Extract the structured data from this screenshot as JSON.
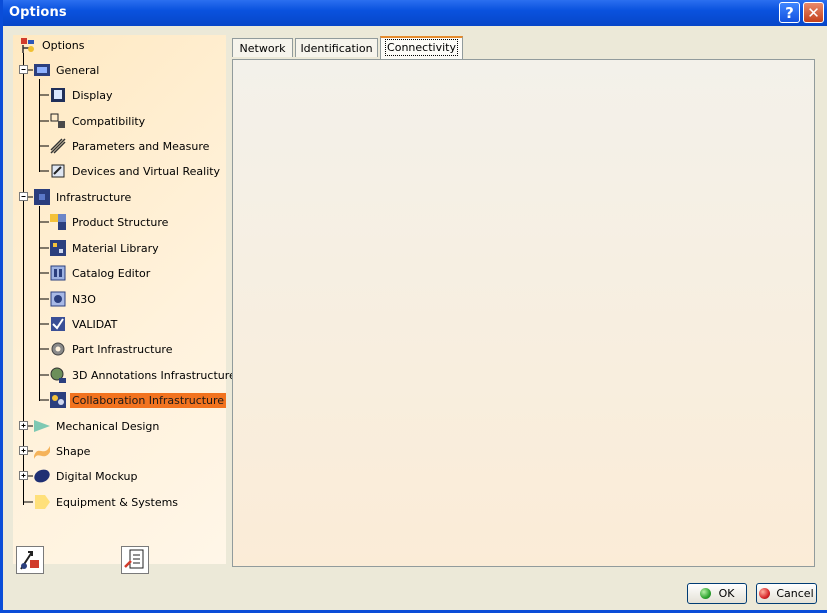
{
  "window": {
    "title": "Options"
  },
  "titlebar": {
    "help_glyph": "?",
    "close_glyph": "✕"
  },
  "tree": {
    "root": "Options",
    "groups": [
      {
        "label": "General",
        "children": [
          "Display",
          "Compatibility",
          "Parameters and Measure",
          "Devices and Virtual Reality"
        ]
      },
      {
        "label": "Infrastructure",
        "children": [
          "Product Structure",
          "Material Library",
          "Catalog Editor",
          "N3O",
          "VALIDAT",
          "Part Infrastructure",
          "3D Annotations Infrastructure",
          "Collaboration Infrastructure"
        ]
      },
      {
        "label": "Mechanical Design"
      },
      {
        "label": "Shape"
      },
      {
        "label": "Digital Mockup"
      },
      {
        "label": "Equipment & Systems"
      }
    ],
    "selected": "Collaboration Infrastructure"
  },
  "tabs": [
    "Network",
    "Identification",
    "Connectivity"
  ],
  "active_tab": "Connectivity",
  "buttons": {
    "ok": "OK",
    "cancel": "Cancel"
  },
  "colors": {
    "title_bar": "#0a52de",
    "selection": "#f2731f",
    "tab_highlight": "#e68b2c",
    "ok_dot": "#2fa531",
    "cancel_dot": "#d8262a"
  }
}
